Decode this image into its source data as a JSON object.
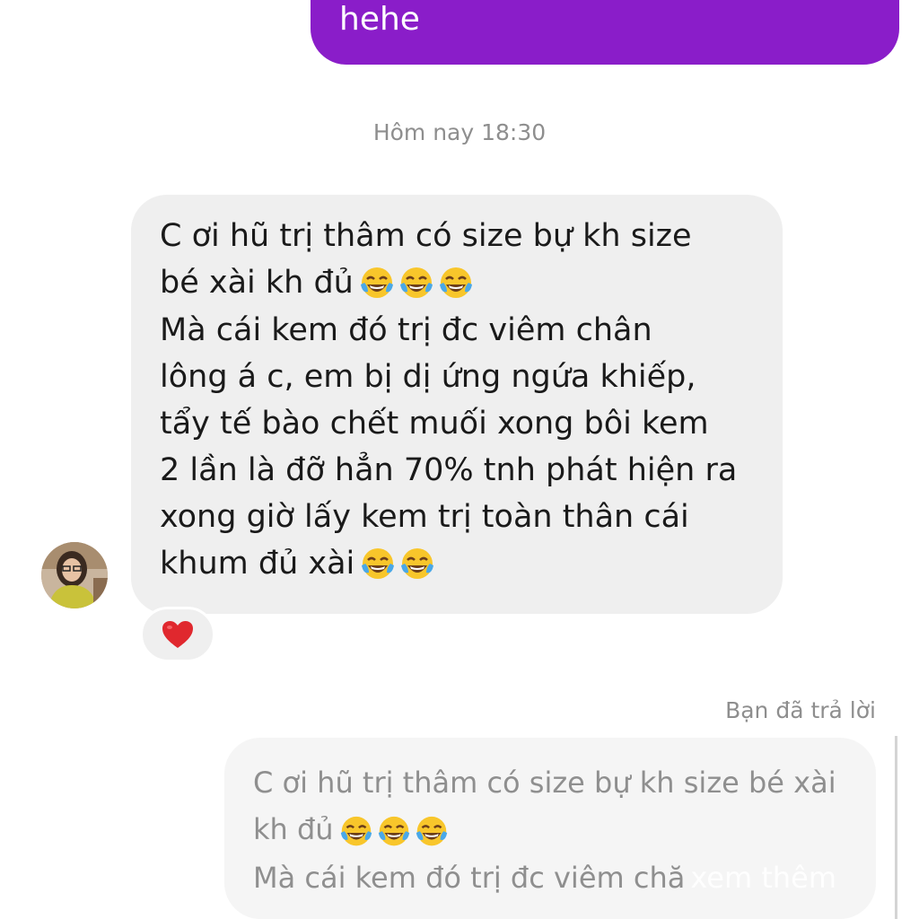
{
  "sent_message": {
    "text": "hehe",
    "color": "#8a1dc9"
  },
  "timestamp": "Hôm nay 18:30",
  "received_message": {
    "lines": [
      "C ơi hũ trị thâm có size bự kh size",
      "bé xài kh đủ",
      "Mà cái kem đó trị đc viêm chân",
      "lông á c, em bị dị ứng ngứa khiếp,",
      "tẩy tế bào chết muối xong bôi kem",
      "2 lần là đỡ hẳn 70% tnh phát hiện ra",
      "xong giờ lấy kem trị toàn thân cái",
      "khum đủ xài"
    ],
    "emojis": [
      "face-with-tears-of-joy-icon",
      "face-with-tears-of-joy-icon",
      "face-with-tears-of-joy-icon"
    ],
    "reaction": "red-heart-icon"
  },
  "reply": {
    "label": "Bạn đã trả lời",
    "lines": [
      "C ơi hũ trị thâm có size bự kh size bé xài",
      "kh đủ",
      "Mà cái kem đó trị đc viêm chă"
    ],
    "see_more": "xem thêm"
  }
}
